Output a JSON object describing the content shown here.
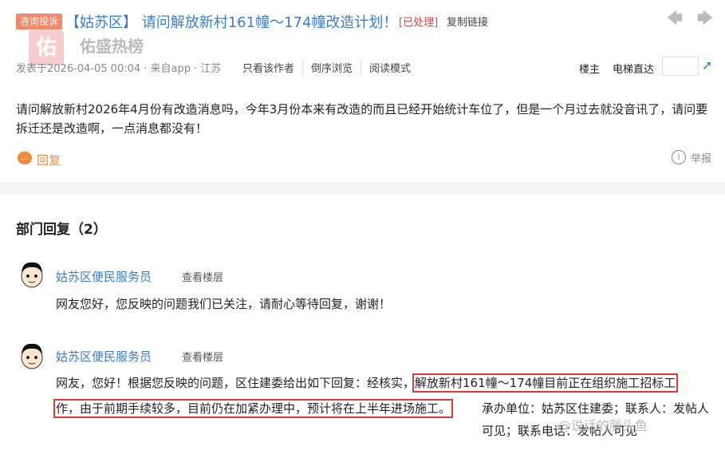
{
  "post": {
    "category_tag": "咨询投诉",
    "title": "【姑苏区】 请问解放新村161幢～174幢改造计划！",
    "status": "[已处理]",
    "copy_link": "复制链接",
    "logo_char": "佑",
    "logo_text": "佑盛热榜",
    "meta": "发表于2026-04-05 00:04 · 来自app · 江苏",
    "meta_links": [
      "只看该作者",
      "倒序浏览",
      "阅读模式"
    ],
    "louzhu": "楼主",
    "elevator": "电梯直达",
    "body": "请问解放新村2026年4月份有改造消息吗，今年3月份本来有改造的而且已经开始统计车位了，但是一个月过去就没音讯了，请问要拆迁还是改造啊，一点消息都没有！",
    "reply_label": "回复",
    "report_label": "举报"
  },
  "replies": {
    "section_title": "部门回复（2）",
    "items": [
      {
        "author": "姑苏区便民服务员",
        "floor_link": "查看楼层",
        "text_before": "网友您好，您反映的问题我们已关注，请耐心等待回复，谢谢！",
        "highlight1": "",
        "highlight2": "",
        "text_after": ""
      },
      {
        "author": "姑苏区便民服务员",
        "floor_link": "查看楼层",
        "text_before": "网友，您好！根据您反映的问题，区住建委给出如下回复：经核实，",
        "highlight1": "解放新村161幢～174幢目前正在组织施工招标工",
        "highlight2": "作，由于前期手续较多，目前仍在加紧办理中，预计将在上半年进场施工。",
        "text_after": "承办单位：姑苏区住建委；联系人：发帖人可见；联系电话：发帖人可见"
      }
    ]
  },
  "watermark": "@说话的胖头鱼",
  "colors": {
    "accent_blue": "#3a7bd5",
    "status_red": "#e0443a",
    "reply_orange": "#f08a3c",
    "highlight_red": "#e53935"
  }
}
